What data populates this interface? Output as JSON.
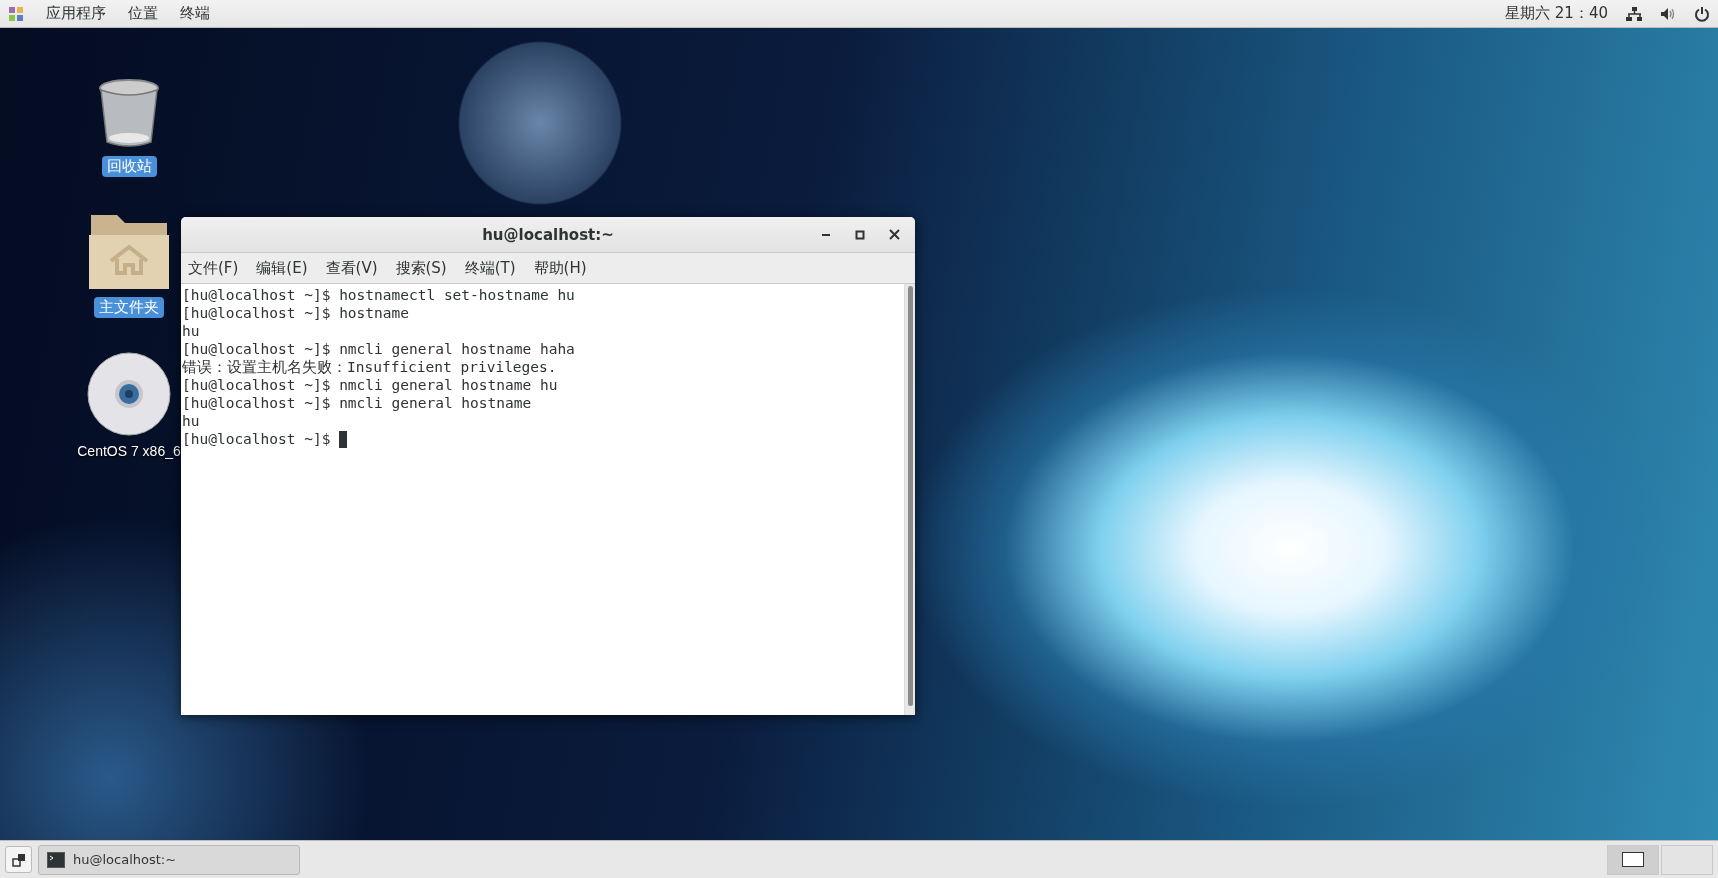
{
  "top_bar": {
    "menus": [
      "应用程序",
      "位置",
      "终端"
    ],
    "clock": "星期六 21：40"
  },
  "desktop_icons": [
    {
      "kind": "trash",
      "label": "回收站",
      "selected": true
    },
    {
      "kind": "home",
      "label": "主文件夹",
      "selected": true
    },
    {
      "kind": "disc",
      "label": "CentOS 7 x86_6",
      "selected": false
    }
  ],
  "terminal": {
    "title": "hu@localhost:~",
    "menu": [
      "文件(F)",
      "编辑(E)",
      "查看(V)",
      "搜索(S)",
      "终端(T)",
      "帮助(H)"
    ],
    "lines": [
      "[hu@localhost ~]$ hostnamectl set-hostname hu",
      "[hu@localhost ~]$ hostname",
      "hu",
      "[hu@localhost ~]$ nmcli general hostname haha",
      "错误：设置主机名失败：Insufficient privileges.",
      "[hu@localhost ~]$ nmcli general hostname hu",
      "[hu@localhost ~]$ nmcli general hostname",
      "hu",
      "[hu@localhost ~]$ "
    ]
  },
  "taskbar": {
    "tasks": [
      {
        "label": "hu@localhost:~",
        "selected": false
      }
    ],
    "workspaces": [
      {
        "selected": true
      },
      {
        "selected": false
      }
    ]
  }
}
